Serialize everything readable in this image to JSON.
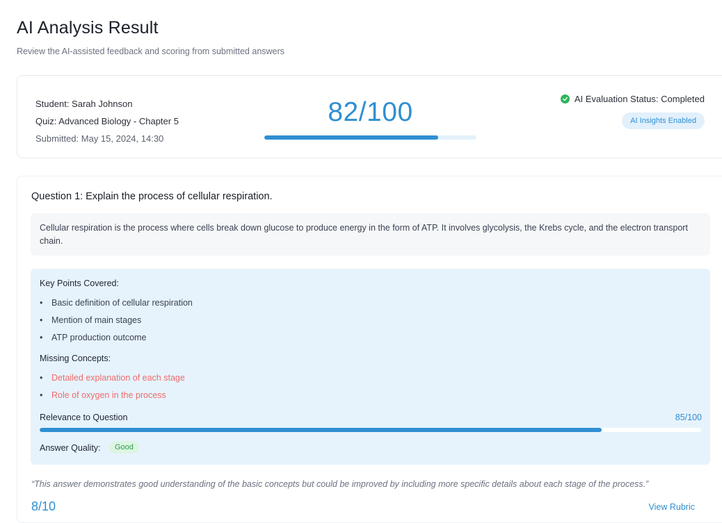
{
  "page": {
    "title": "AI Analysis Result",
    "subtitle": "Review the AI-assisted feedback and scoring from submitted answers"
  },
  "summary": {
    "student": "Student: Sarah Johnson",
    "quiz": "Quiz: Advanced Biology - Chapter 5",
    "submitted": "Submitted: May 15, 2024, 14:30",
    "score_text": "82/100",
    "score_fraction": 0.82,
    "status_text": "AI Evaluation Status: Completed",
    "insights_badge": "AI Insights Enabled"
  },
  "question": {
    "title": "Question 1: Explain the process of cellular respiration.",
    "answer": "Cellular respiration is the process where cells break down glucose to produce energy in the form of ATP. It involves glycolysis, the Krebs cycle, and the electron transport chain.",
    "key_points_label": "Key Points Covered:",
    "key_points": [
      "Basic definition of cellular respiration",
      "Mention of main stages",
      "ATP production outcome"
    ],
    "missing_label": "Missing Concepts:",
    "missing": [
      "Detailed explanation of each stage",
      "Role of oxygen in the process"
    ],
    "relevance_label": "Relevance to Question",
    "relevance_text": "85/100",
    "relevance_fraction": 0.85,
    "quality_label": "Answer Quality:",
    "quality_value": "Good",
    "feedback": "“This answer demonstrates good understanding of the basic concepts but could be improved by including more specific details about each stage of the process.”",
    "points": "8/10",
    "view_rubric": "View Rubric"
  },
  "colors": {
    "accent": "#2f8fd1",
    "success": "#2fb55a",
    "missing": "#ee6b6b"
  },
  "icons": {
    "status": "check-circle-icon",
    "bullet": "bullet-dot-icon"
  }
}
